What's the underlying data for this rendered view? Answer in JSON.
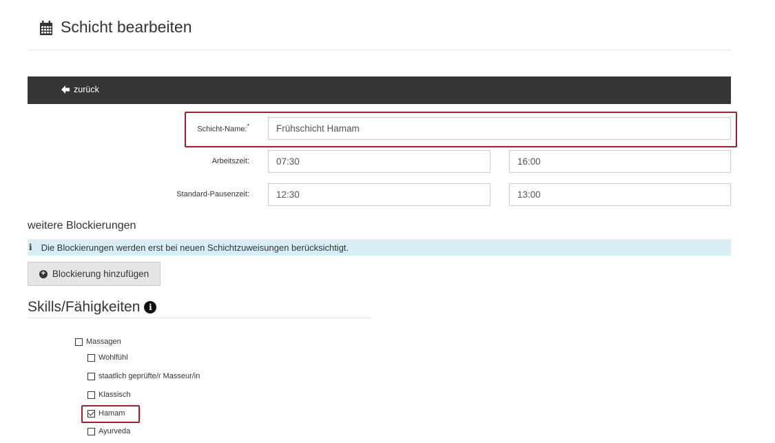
{
  "page": {
    "title": "Schicht bearbeiten",
    "icon": "calendar-icon"
  },
  "toolbar": {
    "back_label": "zurück",
    "back_icon": "arrow-left-icon"
  },
  "form": {
    "name_label": "Schicht-Name:",
    "name_required": "*",
    "name_value": "Frühschicht Hamam",
    "worktime_label": "Arbeitszeit:",
    "worktime_from": "07:30",
    "worktime_to": "16:00",
    "break_label": "Standard-Pausenzeit:",
    "break_from": "12:30",
    "break_to": "13:00"
  },
  "blocks": {
    "heading": "weitere Blockierungen",
    "info_text": "Die Blockierungen werden erst bei neuen Schichtzuweisungen berücksichtigt.",
    "add_label": "Blockierung hinzufügen"
  },
  "skills": {
    "heading": "Skills/Fähigkeiten",
    "parent": {
      "label": "Massagen",
      "checked": false
    },
    "items": [
      {
        "label": "Wohlfühl",
        "checked": false
      },
      {
        "label": "staatlich geprüfte/r Masseur/in",
        "checked": false
      },
      {
        "label": "Klassisch",
        "checked": false
      },
      {
        "label": "Hamam",
        "checked": true
      },
      {
        "label": "Ayurveda",
        "checked": false
      }
    ]
  },
  "colors": {
    "toolbar": "#353535",
    "highlight": "#a61f24",
    "info_bg": "#d9edf7"
  }
}
